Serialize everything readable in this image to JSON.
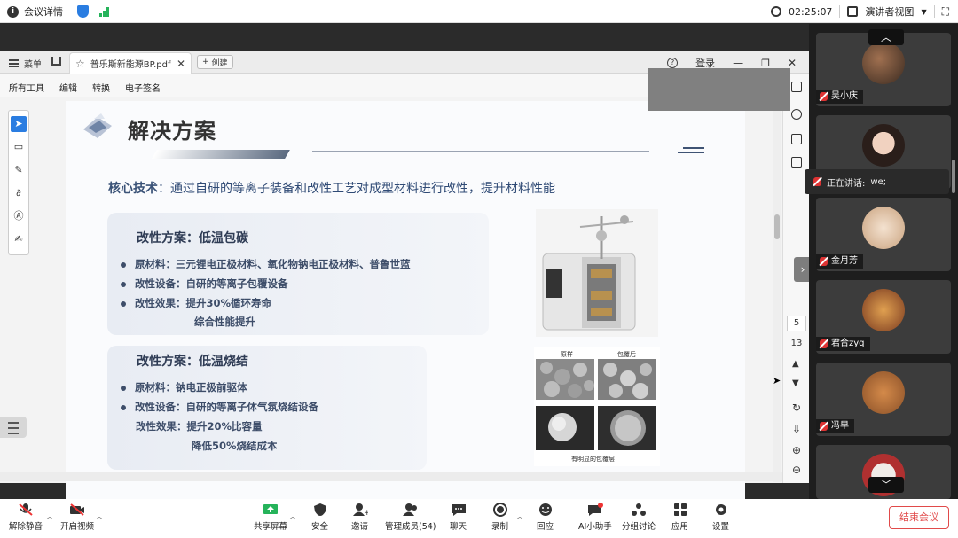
{
  "topbar": {
    "meeting_details": "会议详情",
    "time": "02:25:07",
    "presenter_view": "演讲者视图"
  },
  "pdf": {
    "menu_label": "菜单",
    "tab_title": "普乐斯新能源BP.pdf",
    "new_tab": "创建",
    "login": "登录",
    "toolbar": [
      "所有工具",
      "编辑",
      "转换",
      "电子签名"
    ],
    "page_current": "5",
    "page_total": "13"
  },
  "slide": {
    "title": "解决方案",
    "core_label": "核心技术",
    "core_text": "：通过自研的等离子装备和改性工艺对成型材料进行改性，提升材料性能",
    "section1": {
      "title": "改性方案：低温包碳",
      "items": [
        "原材料：三元锂电正极材料、氧化物钠电正极材料、普鲁世蓝",
        "改性设备：自研的等离子包覆设备",
        "改性效果：提升30%循环寿命"
      ],
      "extra": "综合性能提升"
    },
    "section2": {
      "title": "改性方案：低温烧结",
      "items": [
        "原材料：钠电正极前驱体",
        "改性设备：自研的等离子体气氛烧结设备",
        "改性效果：提升20%比容量"
      ],
      "extra": "降低50%烧结成本"
    },
    "micro": {
      "label_left": "原样",
      "label_right": "包覆后",
      "caption": "有明显的包覆层"
    }
  },
  "participants": {
    "speaking_label": "正在讲话:",
    "speaking_name": "we;",
    "list": [
      "吴小庆",
      "",
      "金月芳",
      "君合zyq",
      "冯早"
    ]
  },
  "bottombar": {
    "unmute": "解除静音",
    "video": "开启视频",
    "share": "共享屏幕",
    "security": "安全",
    "invite": "邀请",
    "members": "管理成员(54)",
    "chat": "聊天",
    "record": "录制",
    "react": "回应",
    "ai": "AI小助手",
    "breakout": "分组讨论",
    "apps": "应用",
    "settings": "设置",
    "end": "结束会议"
  }
}
